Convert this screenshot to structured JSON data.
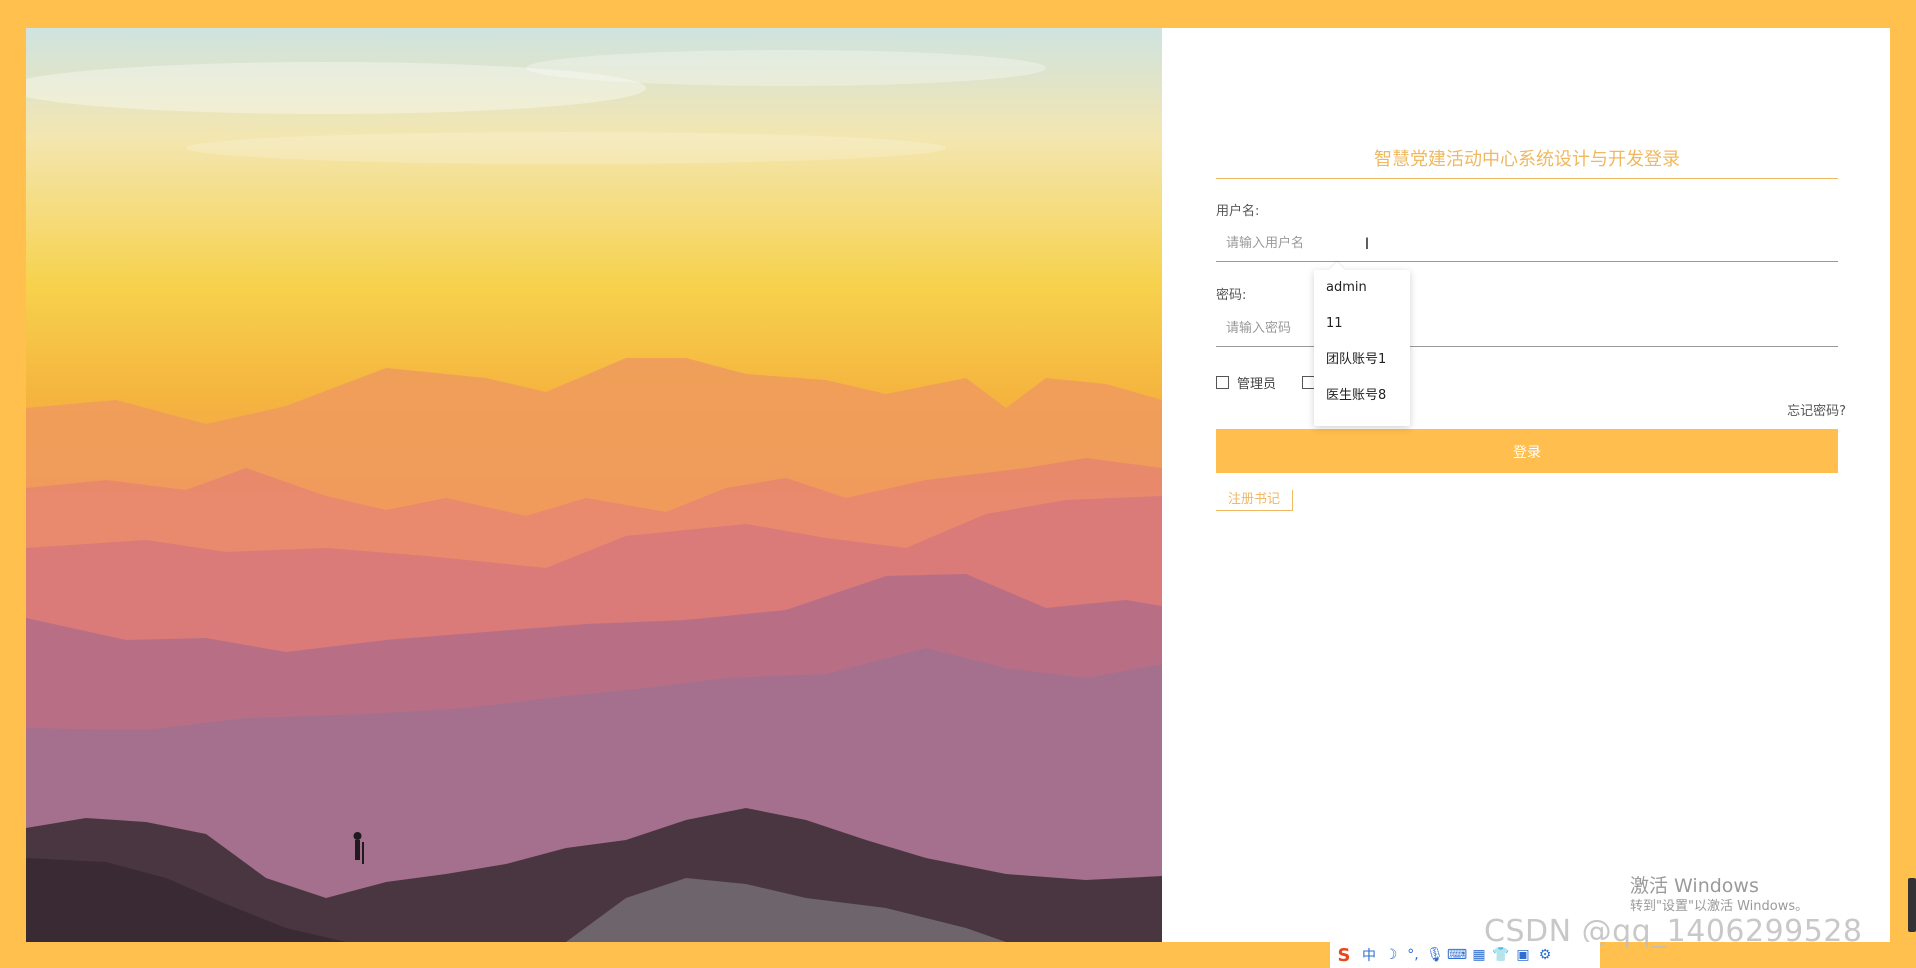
{
  "hero": {
    "description_icon": "mountain-landscape-image"
  },
  "login": {
    "title": "智慧党建活动中心系统设计与开发登录",
    "username_label": "用户名:",
    "username_placeholder": "请输入用户名",
    "password_label": "密码:",
    "password_placeholder": "请输入密码",
    "role_admin_label": "管理员",
    "forgot_link": "忘记密码?",
    "login_button": "登录",
    "register_link": "注册书记"
  },
  "autocomplete": {
    "items": [
      "admin",
      "11",
      "团队账号1",
      "医生账号8"
    ]
  },
  "overlay": {
    "activate_title": "激活 Windows",
    "activate_subtitle": "转到\"设置\"以激活 Windows。",
    "csdn_watermark": "CSDN @qq_1406299528"
  },
  "ime": {
    "mode": "中",
    "icons": [
      "sogou-logo-icon",
      "moon-icon",
      "punctuation-icon",
      "microphone-icon",
      "keyboard-icon",
      "grid-icon",
      "skin-icon",
      "toolbox-icon",
      "settings-icon"
    ]
  },
  "colors": {
    "accent": "#ffbe4d",
    "frame": "#ffc04d",
    "title_text": "#f0b860"
  }
}
